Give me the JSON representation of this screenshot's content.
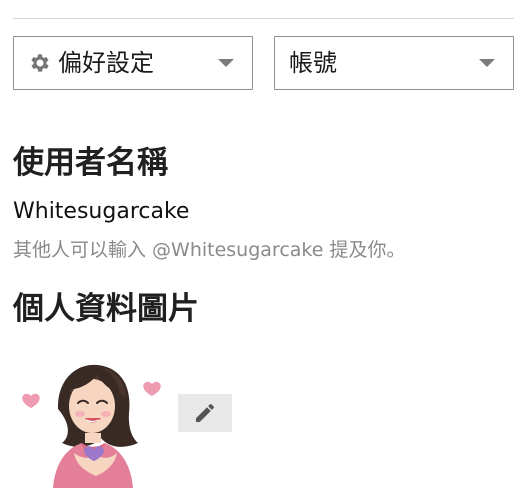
{
  "settings": {
    "preferences_label": "偏好設定",
    "account_label": "帳號",
    "preferences_icon": "gear-icon",
    "dropdown_caret_icon": "caret-down-icon"
  },
  "username_section": {
    "title": "使用者名稱",
    "username": "Whitesugarcake",
    "mention_hint": "其他人可以輸入 @Whitesugarcake 提及你。"
  },
  "profile_picture_section": {
    "title": "個人資料圖片",
    "avatar_description": "woman-with-hearts-illustration",
    "edit_icon": "pencil-icon"
  },
  "colors": {
    "accent_pink": "#e98aa6",
    "button_gray": "#e8e8e8",
    "border_gray": "#8f8f8f"
  }
}
